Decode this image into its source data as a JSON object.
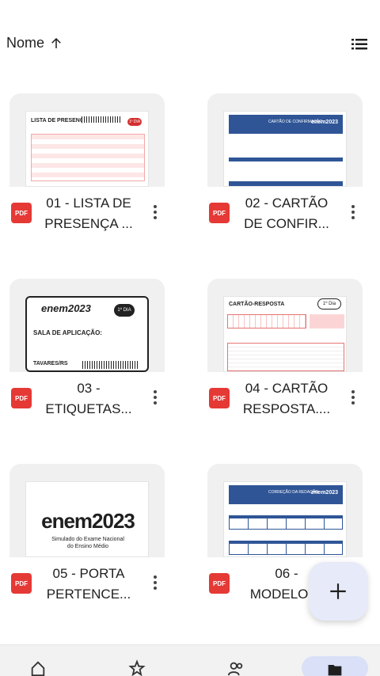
{
  "sort": {
    "label": "Nome"
  },
  "files": [
    {
      "name": "01 - LISTA DE\nPRESENÇA ...",
      "badge": "PDF",
      "thumb_title": "LISTA DE PRESENÇA",
      "thumb_tag": "1º DIA"
    },
    {
      "name": "02 - CARTÃO\nDE CONFIR...",
      "badge": "PDF",
      "thumb_title": "CARTÃO DE CONFIRMAÇÃO",
      "thumb_tag": "enem2023"
    },
    {
      "name": "03 -\nETIQUETAS...",
      "badge": "PDF",
      "thumb_title": "SALA DE APLICAÇÃO:",
      "thumb_tag": "1º DIA",
      "thumb_brand": "enem2023",
      "thumb_footer": "TAVARES/RS"
    },
    {
      "name": "04 - CARTÃO\nRESPOSTA....",
      "badge": "PDF",
      "thumb_title": "CARTÃO-RESPOSTA",
      "thumb_tag": "1º Dia"
    },
    {
      "name": "05 - PORTA\nPERTENCE...",
      "badge": "PDF",
      "thumb_brand": "enem2023",
      "thumb_sub": "Simulado do Exame Nacional\ndo Ensino Médio"
    },
    {
      "name": "06 -\nMODELO ...",
      "badge": "PDF",
      "thumb_title": "CORREÇÃO DA REDAÇÃO",
      "thumb_tag": "enem2023"
    }
  ],
  "colors": {
    "pdf": "#e53935",
    "fab_bg": "#e7eaf8",
    "nav_active": "#d9e0f8",
    "enem_blue": "#2f5597"
  },
  "icons": {
    "sort": "arrow-up-icon",
    "view": "list-view-icon",
    "fab": "plus-icon",
    "more": "more-vert-icon",
    "nav": [
      "home-icon",
      "star-icon",
      "shared-icon",
      "folder-icon"
    ]
  }
}
